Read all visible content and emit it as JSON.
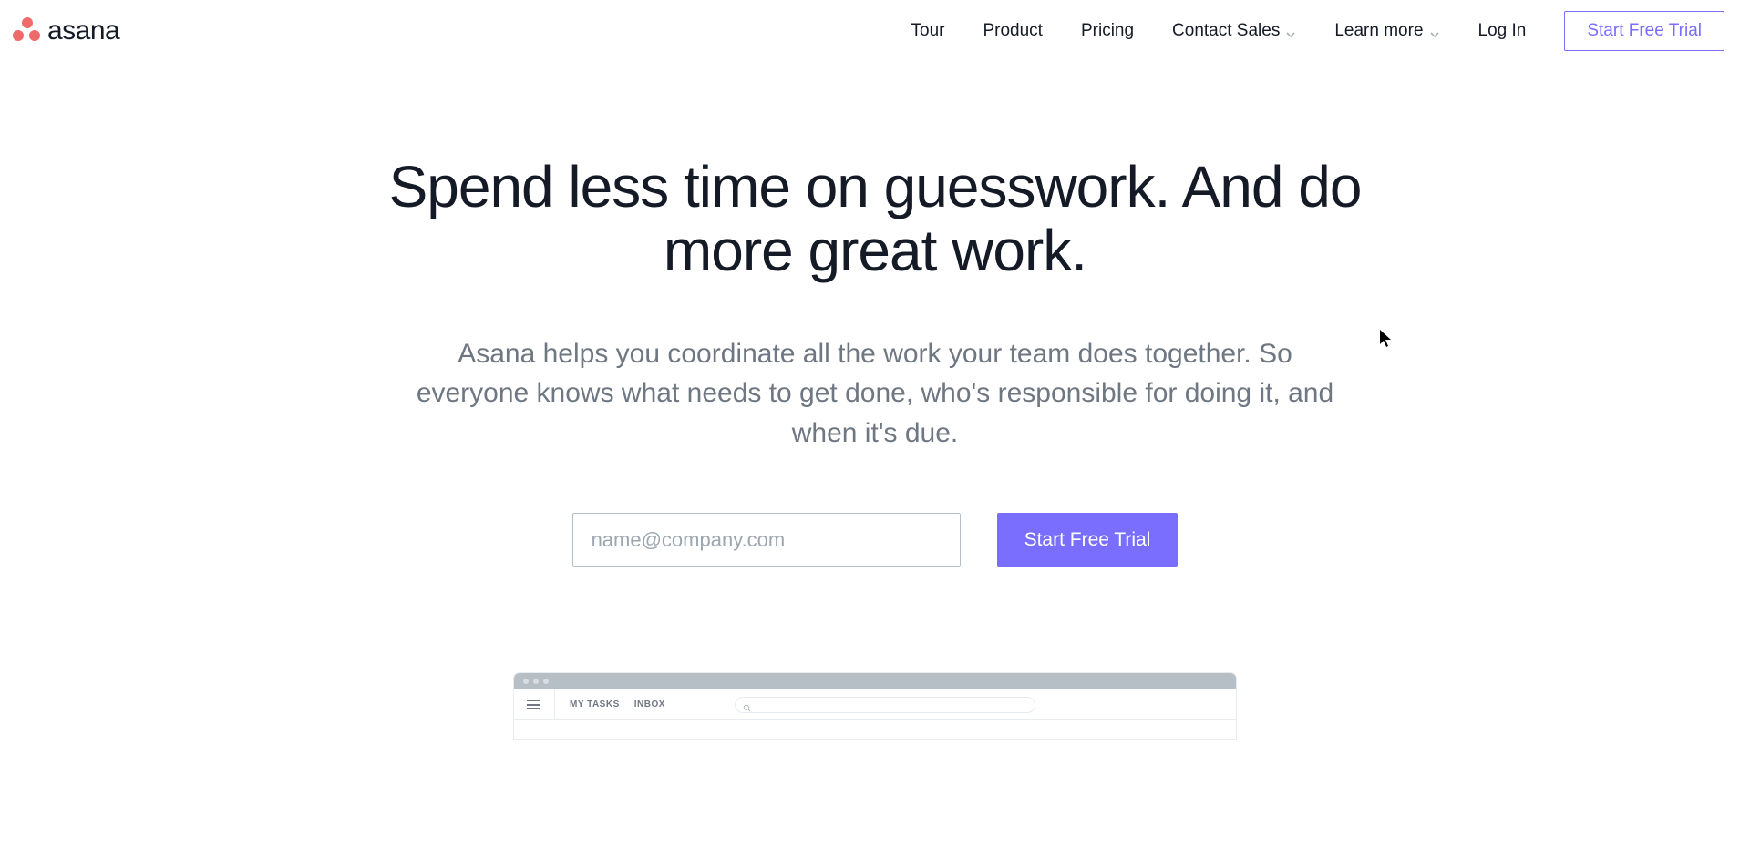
{
  "header": {
    "logo_text": "asana",
    "nav": {
      "tour": "Tour",
      "product": "Product",
      "pricing": "Pricing",
      "contact_sales": "Contact Sales",
      "learn_more": "Learn more",
      "log_in": "Log In"
    },
    "cta": "Start Free Trial"
  },
  "hero": {
    "title": "Spend less time on guesswork. And do more great work.",
    "subtitle": "Asana helps you coordinate all the work your team does together. So everyone knows what needs to get done, who's responsible for doing it, and when it's due."
  },
  "signup": {
    "email_placeholder": "name@company.com",
    "submit_label": "Start Free Trial"
  },
  "app_preview": {
    "tab_my_tasks": "MY TASKS",
    "tab_inbox": "INBOX"
  }
}
